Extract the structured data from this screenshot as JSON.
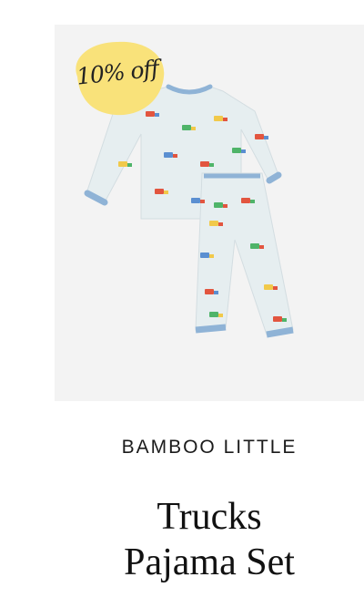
{
  "product": {
    "badge": "10% off",
    "brand": "BAMBOO LITTLE",
    "title_line_1": "Trucks",
    "title_line_2": "Pajama Set"
  },
  "colors": {
    "image_background": "#f3f3f3",
    "badge_fill": "#f9e27a",
    "fabric": "#e6eef0",
    "trim": "#8fb3d6"
  },
  "icons": {
    "badge": "sale-sticker",
    "pattern": "truck-icon"
  }
}
